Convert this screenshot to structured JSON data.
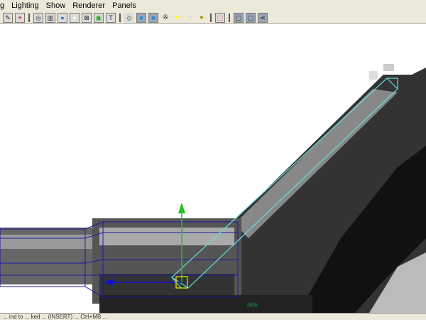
{
  "menu": [
    "g",
    "Lighting",
    "Show",
    "Renderer",
    "Panels"
  ],
  "toolbar": {
    "icons": [
      "camera-attribute-icon",
      "bookmark-icon",
      "image-plane-icon",
      "wireframe-icon",
      "smooth-shade-icon",
      "flat-shade-icon",
      "bounding-box-icon",
      "texture-icon",
      "text-icon",
      "isolate-icon",
      "xray-icon",
      "xray-joint-icon",
      "checker-icon",
      "lighting-default-icon",
      "lighting-all-icon",
      "lighting-shadow-icon",
      "select-camera-icon",
      "quad-view-icon",
      "two-view-icon",
      "graph-icon"
    ]
  },
  "viewport": {
    "axis_label": "side",
    "mesh_color": "#1a1aa0",
    "selection_color": "#66dddd",
    "manipulator_y_color": "#20c020",
    "manipulator_x_color": "#1010e0"
  },
  "status": {
    "text": "... ind to ... ked ... (INSERT) ... Ctrl+MB ..."
  }
}
